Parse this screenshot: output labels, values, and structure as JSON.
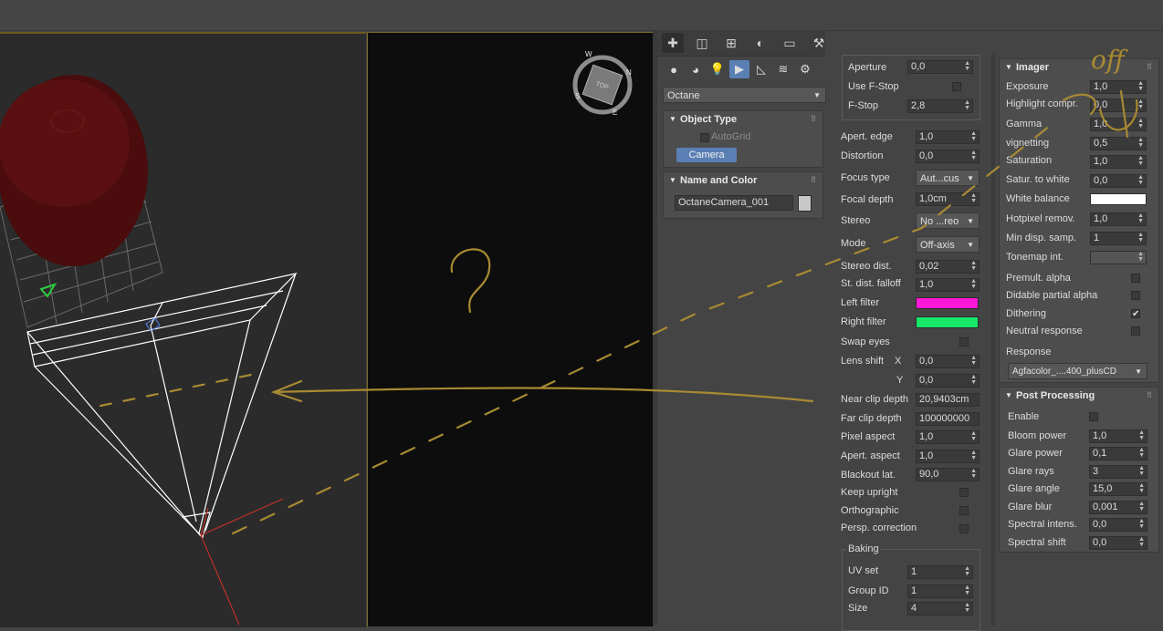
{
  "colors": {
    "accent_blue": "#5a7fb5",
    "left_filter": "#ff17d6",
    "right_filter": "#17e86a",
    "white_balance": "#ffffff",
    "annotation": "#a88a32"
  },
  "annotations": {
    "question_mark": "?",
    "off_text": "off"
  },
  "viewcube": {
    "top": "TOP",
    "n": "N",
    "w": "W",
    "s": "S",
    "e": "E"
  },
  "cmd": {
    "tabs": [
      "create-icon",
      "modify-icon",
      "hierarchy-icon",
      "motion-icon",
      "display-icon",
      "utilities-icon"
    ],
    "renderer_dropdown": "Octane",
    "object_type": {
      "title": "Object Type",
      "autogrid": "AutoGrid",
      "camera_button": "Camera"
    },
    "name_color": {
      "title": "Name and Color",
      "name": "OctaneCamera_001"
    }
  },
  "camera": {
    "aperture_label": "Aperture",
    "aperture": "0,0",
    "use_fstop": "Use F-Stop",
    "fstop_label": "F-Stop",
    "fstop": "2,8",
    "apert_edge_label": "Apert. edge",
    "apert_edge": "1,0",
    "distortion_label": "Distortion",
    "distortion": "0,0",
    "focus_type_label": "Focus type",
    "focus_type": "Aut...cus",
    "focal_depth_label": "Focal depth",
    "focal_depth": "1,0cm",
    "stereo_label": "Stereo",
    "stereo": "No ...reo",
    "mode_label": "Mode",
    "mode": "Off-axis",
    "stereo_dist_label": "Stereo dist.",
    "stereo_dist": "0,02",
    "st_dist_falloff_label": "St. dist. falloff",
    "st_dist_falloff": "1,0",
    "left_filter_label": "Left filter",
    "right_filter_label": "Right filter",
    "swap_eyes_label": "Swap eyes",
    "lens_shift_label": "Lens shift",
    "lens_shift_x_label": "X",
    "lens_shift_x": "0,0",
    "lens_shift_y_label": "Y",
    "lens_shift_y": "0,0",
    "near_clip_label": "Near clip depth",
    "near_clip": "20,9403cm",
    "far_clip_label": "Far clip depth",
    "far_clip": "100000000",
    "pixel_aspect_label": "Pixel aspect",
    "pixel_aspect": "1,0",
    "apert_aspect_label": "Apert. aspect",
    "apert_aspect": "1,0",
    "blackout_label": "Blackout lat.",
    "blackout": "90,0",
    "keep_upright_label": "Keep upright",
    "orthographic_label": "Orthographic",
    "persp_correction_label": "Persp. correction",
    "baking_label": "Baking",
    "uv_set_label": "UV set",
    "uv_set": "1",
    "group_id_label": "Group ID",
    "group_id": "1",
    "size_label": "Size",
    "size": "4"
  },
  "imager": {
    "title": "Imager",
    "exposure_label": "Exposure",
    "exposure": "1,0",
    "highlight_label": "Highlight compr.",
    "highlight": "0,0",
    "gamma_label": "Gamma",
    "gamma": "1,0",
    "vignetting_label": "vignetting",
    "vignetting": "0,5",
    "saturation_label": "Saturation",
    "saturation": "1,0",
    "satur_white_label": "Satur. to white",
    "satur_white": "0,0",
    "white_balance_label": "White balance",
    "hotpixel_label": "Hotpixel remov.",
    "hotpixel": "1,0",
    "min_disp_label": "Min disp. samp.",
    "min_disp": "1",
    "tonemap_label": "Tonemap int.",
    "premult_label": "Premult. alpha",
    "didable_label": "Didable partial alpha",
    "dithering_label": "Dithering",
    "neutral_label": "Neutral response",
    "response_label": "Response",
    "response": "Agfacolor_....400_plusCD"
  },
  "post": {
    "title": "Post Processing",
    "enable_label": "Enable",
    "bloom_power_label": "Bloom power",
    "bloom_power": "1,0",
    "glare_power_label": "Glare power",
    "glare_power": "0,1",
    "glare_rays_label": "Glare rays",
    "glare_rays": "3",
    "glare_angle_label": "Glare angle",
    "glare_angle": "15,0",
    "glare_blur_label": "Glare blur",
    "glare_blur": "0,001",
    "spectral_intens_label": "Spectral intens.",
    "spectral_intens": "0,0",
    "spectral_shift_label": "Spectral shift",
    "spectral_shift": "0,0"
  }
}
